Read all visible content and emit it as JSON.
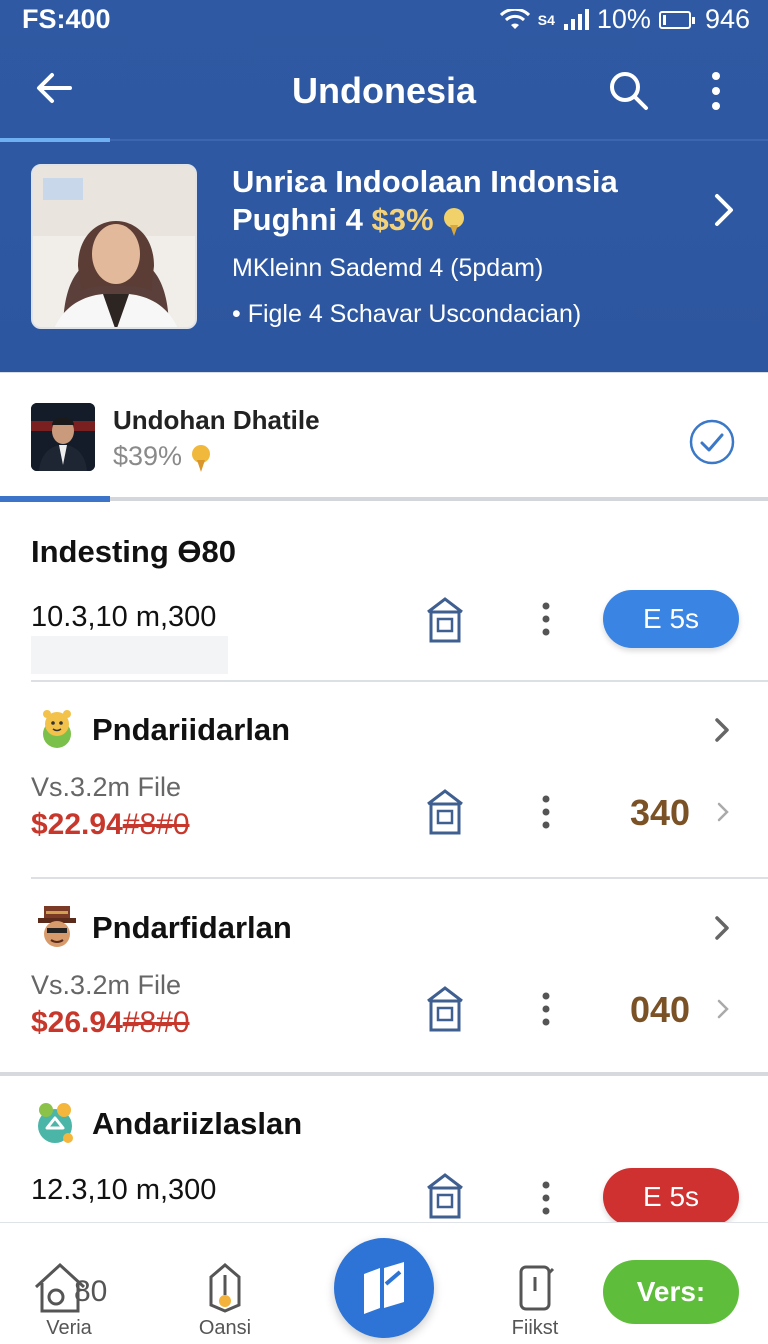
{
  "status_bar": {
    "left_text": "FS:400",
    "network": "S4",
    "battery": "10%",
    "battery_fraction": 0.1,
    "time": "946"
  },
  "app_bar": {
    "title": "Undonesia",
    "icons": [
      "back-arrow-icon",
      "search-icon",
      "more-vert-icon"
    ]
  },
  "profile_card": {
    "line1": "Unriɛa Indoolaan Indonsia",
    "line2_text": "Pughni 4",
    "line2_price": "$3%",
    "line3": "MKleinn Sademd 4 (5pdam)",
    "line4": "• Figle 4 Schavar Uscondacian)"
  },
  "account": {
    "name": "Undohan Dhatile",
    "percent": "$39%"
  },
  "section": {
    "title": "Indesting Ɵ80",
    "value": "10.3,10 m,300",
    "button": "E 5s"
  },
  "items": [
    {
      "title": "Pndariidarlan",
      "sub": "Vs.3.2m File",
      "price": "$22.94",
      "price_strike": "#8#0",
      "qty": "340"
    },
    {
      "title": "Pndarfidarlan",
      "sub": "Vs.3.2m File",
      "price": "$26.94",
      "price_strike": "#8#0",
      "qty": "040"
    }
  ],
  "last_item": {
    "title": "Andariizlaslan",
    "value": "12.3,10 m,300",
    "button": "E 5s"
  },
  "bottom_nav": {
    "home_label": "Veria",
    "home_badge": "80",
    "item2_label": "Oansi",
    "item4_label": "Fiikst",
    "action_label": "Vers:"
  },
  "colors": {
    "header_blue": "#2f5aa3",
    "pill_blue": "#3a84e3",
    "pill_red": "#cf3030",
    "price_red": "#c8372c",
    "qty_brown": "#7a5226",
    "action_green": "#5fbd3c"
  }
}
